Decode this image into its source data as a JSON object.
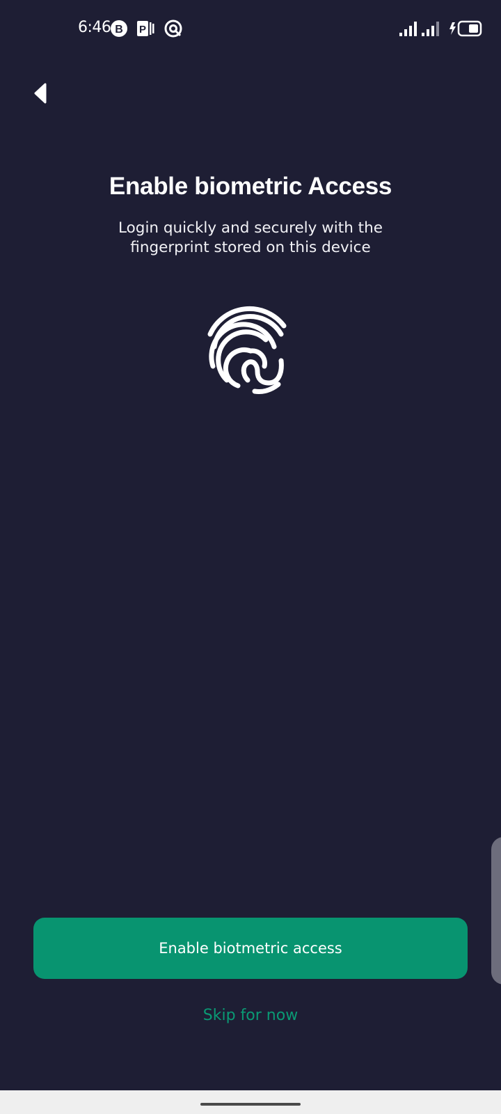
{
  "status_bar": {
    "time": "6:46",
    "icons": [
      "b-circle-icon",
      "parking-app-icon",
      "q-circle-icon"
    ],
    "signal_icons": [
      "signal-strength-icon",
      "signal-strength-icon"
    ],
    "battery_icon": "battery-charging-icon"
  },
  "header": {
    "back_icon": "back-arrow-icon"
  },
  "main": {
    "title": "Enable biometric Access",
    "subtitle": "Login quickly and securely with the fingerprint stored on this device",
    "illustration_icon": "fingerprint-icon"
  },
  "actions": {
    "primary_label": "Enable biotmetric access",
    "skip_label": "Skip for now"
  },
  "colors": {
    "background": "#1e1e34",
    "accent": "#089470",
    "link": "#0a9a74",
    "text": "#ffffff"
  }
}
